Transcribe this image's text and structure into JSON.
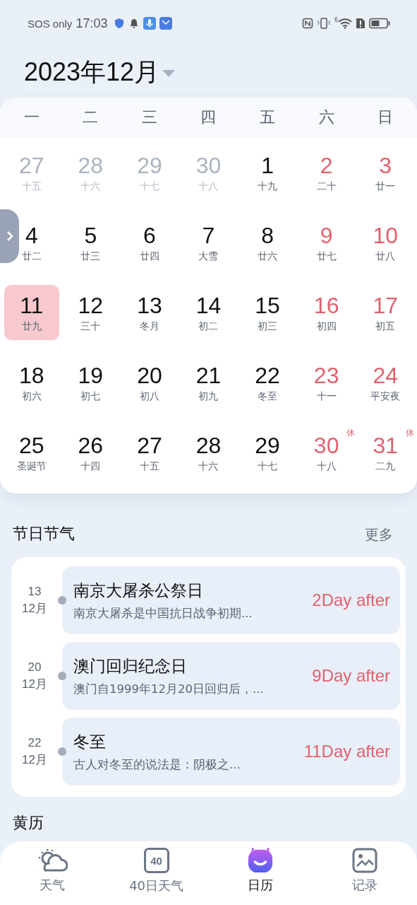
{
  "status_bar": {
    "carrier": "SOS only",
    "time": "17:03",
    "wifi_badge": "6"
  },
  "header": {
    "title": "2023年12月"
  },
  "calendar": {
    "weekdays": [
      "一",
      "二",
      "三",
      "四",
      "五",
      "六",
      "日"
    ],
    "days": [
      {
        "day": "27",
        "lunar": "十五",
        "kind": "other",
        "selected": false
      },
      {
        "day": "28",
        "lunar": "十六",
        "kind": "other",
        "selected": false
      },
      {
        "day": "29",
        "lunar": "十七",
        "kind": "other",
        "selected": false
      },
      {
        "day": "30",
        "lunar": "十八",
        "kind": "other",
        "selected": false
      },
      {
        "day": "1",
        "lunar": "十九",
        "kind": "weekday",
        "selected": false
      },
      {
        "day": "2",
        "lunar": "二十",
        "kind": "weekend",
        "selected": false
      },
      {
        "day": "3",
        "lunar": "廿一",
        "kind": "weekend",
        "selected": false
      },
      {
        "day": "4",
        "lunar": "廿二",
        "kind": "weekday",
        "selected": false
      },
      {
        "day": "5",
        "lunar": "廿三",
        "kind": "weekday",
        "selected": false
      },
      {
        "day": "6",
        "lunar": "廿四",
        "kind": "weekday",
        "selected": false
      },
      {
        "day": "7",
        "lunar": "大雪",
        "kind": "weekday",
        "selected": false
      },
      {
        "day": "8",
        "lunar": "廿六",
        "kind": "weekday",
        "selected": false
      },
      {
        "day": "9",
        "lunar": "廿七",
        "kind": "weekend",
        "selected": false
      },
      {
        "day": "10",
        "lunar": "廿八",
        "kind": "weekend",
        "selected": false
      },
      {
        "day": "11",
        "lunar": "廿九",
        "kind": "weekday",
        "selected": true
      },
      {
        "day": "12",
        "lunar": "三十",
        "kind": "weekday",
        "selected": false
      },
      {
        "day": "13",
        "lunar": "冬月",
        "kind": "weekday",
        "selected": false
      },
      {
        "day": "14",
        "lunar": "初二",
        "kind": "weekday",
        "selected": false
      },
      {
        "day": "15",
        "lunar": "初三",
        "kind": "weekday",
        "selected": false
      },
      {
        "day": "16",
        "lunar": "初四",
        "kind": "weekend",
        "selected": false
      },
      {
        "day": "17",
        "lunar": "初五",
        "kind": "weekend",
        "selected": false
      },
      {
        "day": "18",
        "lunar": "初六",
        "kind": "weekday",
        "selected": false
      },
      {
        "day": "19",
        "lunar": "初七",
        "kind": "weekday",
        "selected": false
      },
      {
        "day": "20",
        "lunar": "初八",
        "kind": "weekday",
        "selected": false
      },
      {
        "day": "21",
        "lunar": "初九",
        "kind": "weekday",
        "selected": false
      },
      {
        "day": "22",
        "lunar": "冬至",
        "kind": "weekday",
        "selected": false
      },
      {
        "day": "23",
        "lunar": "十一",
        "kind": "weekend",
        "selected": false
      },
      {
        "day": "24",
        "lunar": "平安夜",
        "kind": "weekend",
        "selected": false
      },
      {
        "day": "25",
        "lunar": "圣诞节",
        "kind": "weekday",
        "selected": false
      },
      {
        "day": "26",
        "lunar": "十四",
        "kind": "weekday",
        "selected": false
      },
      {
        "day": "27",
        "lunar": "十五",
        "kind": "weekday",
        "selected": false
      },
      {
        "day": "28",
        "lunar": "十六",
        "kind": "weekday",
        "selected": false
      },
      {
        "day": "29",
        "lunar": "十七",
        "kind": "weekday",
        "selected": false
      },
      {
        "day": "30",
        "lunar": "十八",
        "kind": "weekend",
        "selected": false,
        "badge": "休"
      },
      {
        "day": "31",
        "lunar": "二九",
        "kind": "weekend",
        "selected": false,
        "badge": "休"
      }
    ]
  },
  "festivals": {
    "title": "节日节气",
    "more": "更多",
    "items": [
      {
        "day": "13",
        "month": "12月",
        "name": "南京大屠杀公祭日",
        "summary": "南京大屠杀是中国抗日战争初期...",
        "countdown": "2Day after"
      },
      {
        "day": "20",
        "month": "12月",
        "name": "澳门回归纪念日",
        "summary": "澳门自1999年12月20日回归后，...",
        "countdown": "9Day after"
      },
      {
        "day": "22",
        "month": "12月",
        "name": "冬至",
        "summary": "古人对冬至的说法是：阴极之...",
        "countdown": "11Day after"
      }
    ]
  },
  "almanac": {
    "title": "黄历"
  },
  "bottom_nav": [
    {
      "label": "天气",
      "selected": false
    },
    {
      "label": "40日天气",
      "icon_text": "40",
      "selected": false
    },
    {
      "label": "日历",
      "selected": true
    },
    {
      "label": "记录",
      "selected": false
    }
  ]
}
